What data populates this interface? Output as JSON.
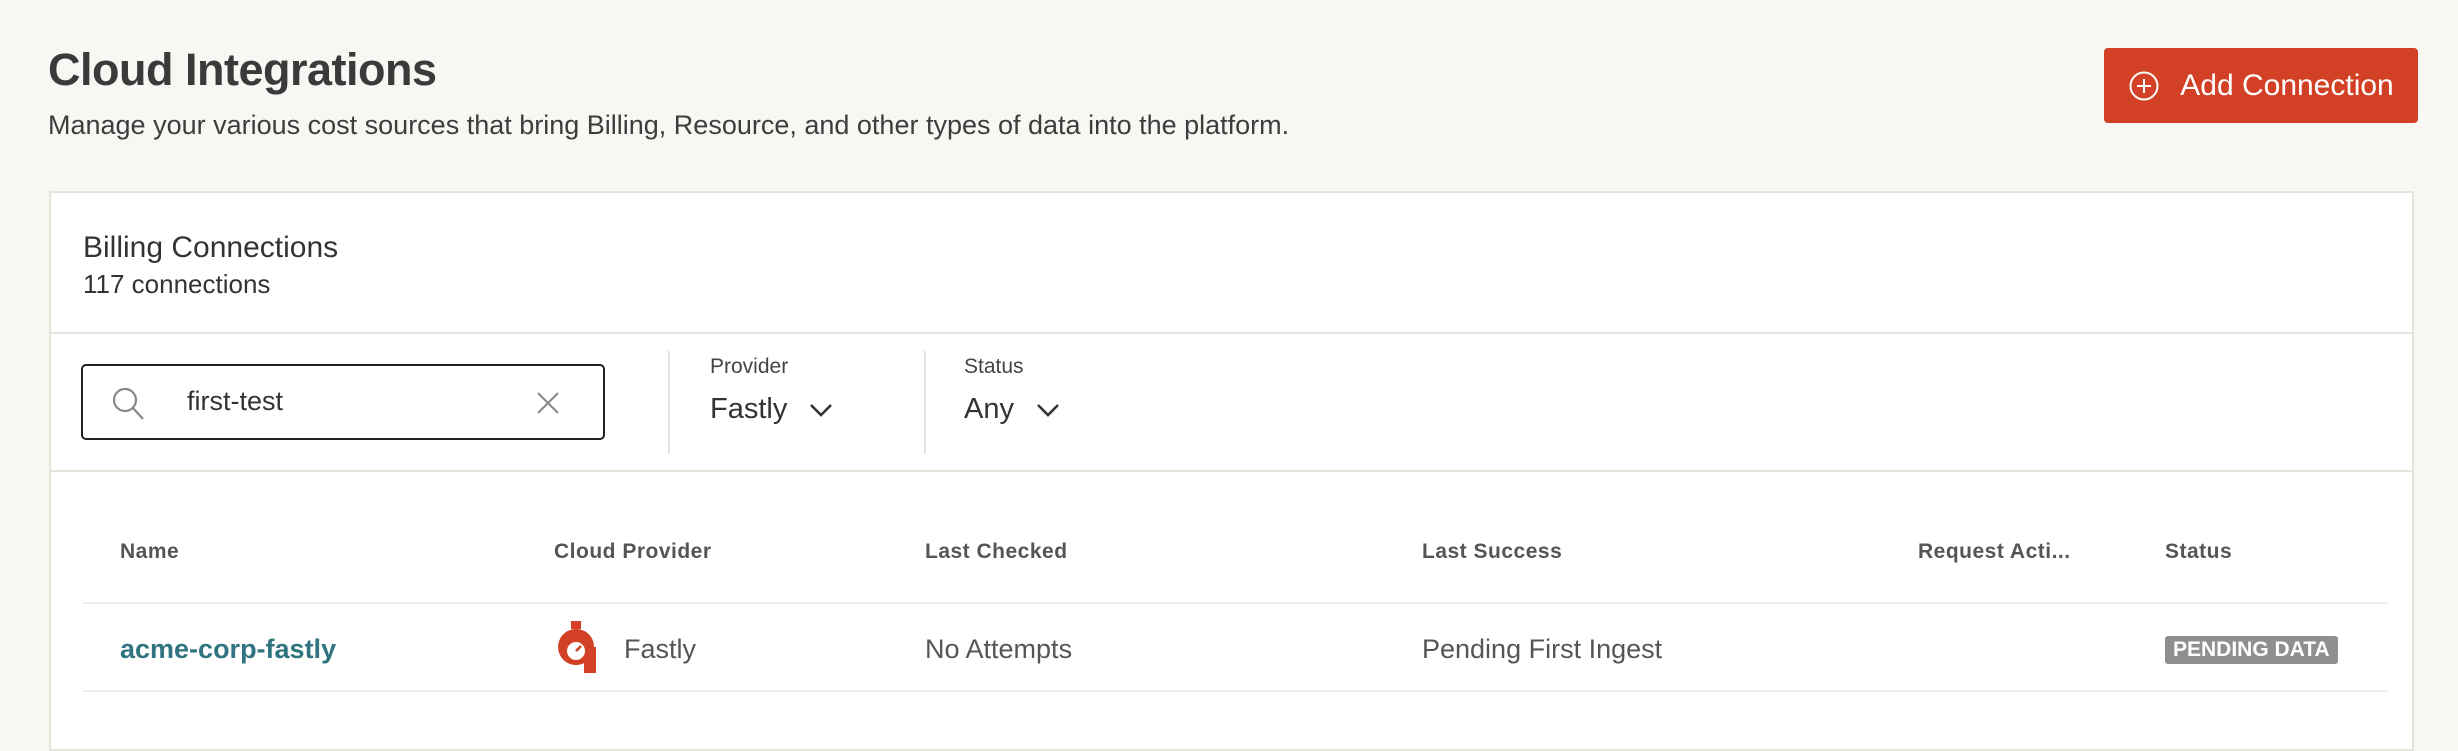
{
  "header": {
    "title": "Cloud Integrations",
    "subtitle": "Manage your various cost sources that bring Billing, Resource, and other types of data into the platform.",
    "add_button_label": "Add Connection"
  },
  "card": {
    "title": "Billing Connections",
    "count": "117 connections"
  },
  "filters": {
    "search_value": "first-test",
    "provider_label": "Provider",
    "provider_value": "Fastly",
    "status_label": "Status",
    "status_value": "Any"
  },
  "table": {
    "columns": [
      "Name",
      "Cloud Provider",
      "Last Checked",
      "Last Success",
      "Request Acti...",
      "Status"
    ],
    "rows": [
      {
        "name": "acme-corp-fastly",
        "provider": "Fastly",
        "last_checked": "No Attempts",
        "last_success": "Pending First Ingest",
        "request_action": "",
        "status": "PENDING DATA"
      }
    ]
  },
  "colors": {
    "accent": "#d24025",
    "link": "#2f7480",
    "badge": "#8f8f8f"
  }
}
